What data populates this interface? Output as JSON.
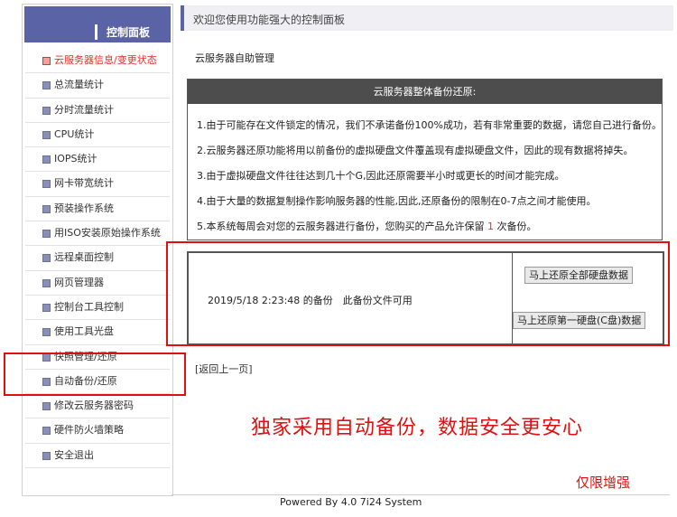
{
  "sidebar": {
    "header": "控制面板",
    "items": [
      {
        "label": "云服务器信息/变更状态",
        "active": true
      },
      {
        "label": "总流量统计"
      },
      {
        "label": "分时流量统计"
      },
      {
        "label": "CPU统计"
      },
      {
        "label": "IOPS统计"
      },
      {
        "label": "网卡带宽统计"
      },
      {
        "label": "预装操作系统"
      },
      {
        "label": "用ISO安装原始操作系统"
      },
      {
        "label": "远程桌面控制"
      },
      {
        "label": "网页管理器"
      },
      {
        "label": "控制台工具控制"
      },
      {
        "label": "使用工具光盘"
      },
      {
        "label": "快照管理/还原"
      },
      {
        "label": "自动备份/还原"
      },
      {
        "label": "修改云服务器密码"
      },
      {
        "label": "硬件防火墙策略"
      },
      {
        "label": "安全退出"
      }
    ]
  },
  "header": {
    "welcome": "欢迎您使用功能强大的控制面板"
  },
  "main": {
    "section_title": "云服务器自助管理",
    "panel_title": "云服务器整体备份还原:",
    "notes": [
      "1.由于可能存在文件锁定的情况，我们不承诺备份100%成功，若有非常重要的数据，请您自己进行备份。",
      "2.云服务器还原功能将用以前备份的虚拟硬盘文件覆盖现有虚拟硬盘文件，因此的现有数据将掉失。",
      "3.由于虚拟硬盘文件往往达到几十个G,因此还原需要半小时或更长的时间才能完成。",
      "4.由于大量的数据复制操作影响服务器的性能,因此,还原备份的限制在0-7点之间才能使用。"
    ],
    "note5_prefix": "5.本系统每周会对您的云服务器进行备份，您购买的产品允许保留",
    "note5_count": "1",
    "note5_suffix": "次备份。",
    "backup_info": "2019/5/18 2:23:48 的备份　此备份文件可用",
    "restore_all_label": "马上还原全部硬盘数据",
    "restore_first_label": "马上还原第一硬盘(C盘)数据",
    "back_link": "[返回上一页]"
  },
  "annotations": {
    "promo": "独家采用自动备份，数据安全更安心",
    "promo2": "仅限增强"
  },
  "footer": {
    "text": "Powered By 4.0 7i24 System"
  },
  "colors": {
    "accent": "#5a63a6",
    "panel_head": "#4d4d4d",
    "highlight": "#e01010"
  }
}
